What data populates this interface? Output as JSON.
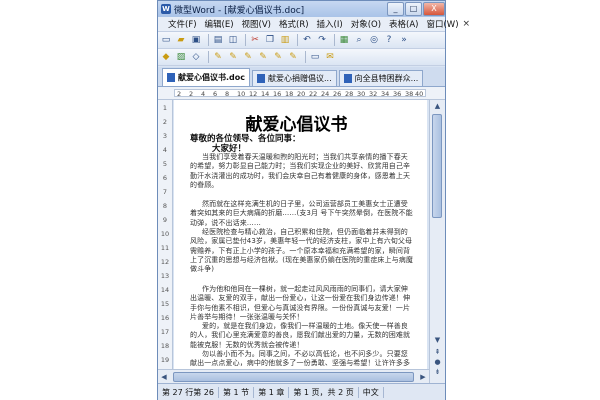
{
  "window": {
    "title": "微型Word - [献爱心倡议书.doc]",
    "app_icon": "W"
  },
  "controls": {
    "minimize": "_",
    "maximize": "□",
    "close": "X"
  },
  "menu": {
    "items": [
      "文件(F)",
      "编辑(E)",
      "视图(V)",
      "格式(R)",
      "插入(I)",
      "对象(O)",
      "表格(A)",
      "窗口(W)"
    ],
    "close": "×"
  },
  "tabs": [
    {
      "label": "献爱心倡议书.doc",
      "active": true
    },
    {
      "label": "献爱心捐赠倡议...",
      "active": false
    },
    {
      "label": "向全县特困群众..."
    }
  ],
  "ruler": {
    "numbers": [
      "2",
      "2",
      "4",
      "6",
      "8",
      "10",
      "12",
      "14",
      "16",
      "18",
      "20",
      "22",
      "24",
      "26",
      "28",
      "30",
      "32",
      "34",
      "36",
      "38",
      "40"
    ]
  },
  "line_numbers": [
    "1",
    "2",
    "3",
    "4",
    "5",
    "6",
    "7",
    "8",
    "9",
    "10",
    "11",
    "12",
    "13",
    "14",
    "15",
    "16",
    "17",
    "18",
    "19"
  ],
  "document": {
    "title": "献爱心倡议书",
    "greeting": "尊敬的各位领导、各位同事：",
    "hello": "大家好！",
    "paragraphs": [
      "当我们享受着春天温暖和煦的阳光时；当我们共享亲情的播下春天的希望，努力彰显自己能力时；当我们实现企业的美好、欣赏用自己辛勤汗水浇灌出的成功时，我们会庆幸自己有着健康的身体，感恩着上天的眷顾。",
      "然而就在这样充满生机的日子里，公司运营部员工美惠女士正遭受着突如其来的巨大病痛的折磨……(支3月 号下午突然晕倒，在医院不能动弹，说不出话来……",
      "经医院检查与精心救治，自己积累和住院，但仍面临着并未得到的风险，家属已垫付43岁，美惠年轻一代的经济支柱，家中上有六旬父母需赡养，下有正上小学的孩子。一个原本幸福和充满希望的家，瞬间背上了沉重的思想与经济包袱。(现在美惠家仍躺在医院的重症床上与病魔做斗争)",
      "作为他和他同在一棵树，就一起走过风风雨雨的同事们，请大家伸出温暖、友爱的双手，献出一份爱心，让这一份爱在我们身边传递！伸手你与他素不相识，但爱心与真诚没有界限。一份份真诚与友爱！一片片善举与期待！一张张温暖与关怀！",
      "爱的，就是在我们身边，像我们一样温暖的土地。像天使一样善良的人，我们心里充满爱意的善良，愿我们献出爱的力量，无数的困难就能被克服！无数的优秀就会被传递！",
      "勿以善小而不为。同事之间，不必以高低论，也不问多少。只要您献出一点点爱心，病中的他就多了一份勇敢、坚强与希望！让许许多多温暖汇聚而成，让他感受到人间真情，让爱温暖他……"
    ]
  },
  "status": {
    "items": [
      "第 27 行第 26",
      "第 1 节",
      "第 1 章",
      "第 1 页，共 2 页",
      "中文"
    ]
  },
  "colors": {
    "title_bar": "#a9c3e8",
    "window_border": "#6d8cb9",
    "close": "#d5563c"
  }
}
